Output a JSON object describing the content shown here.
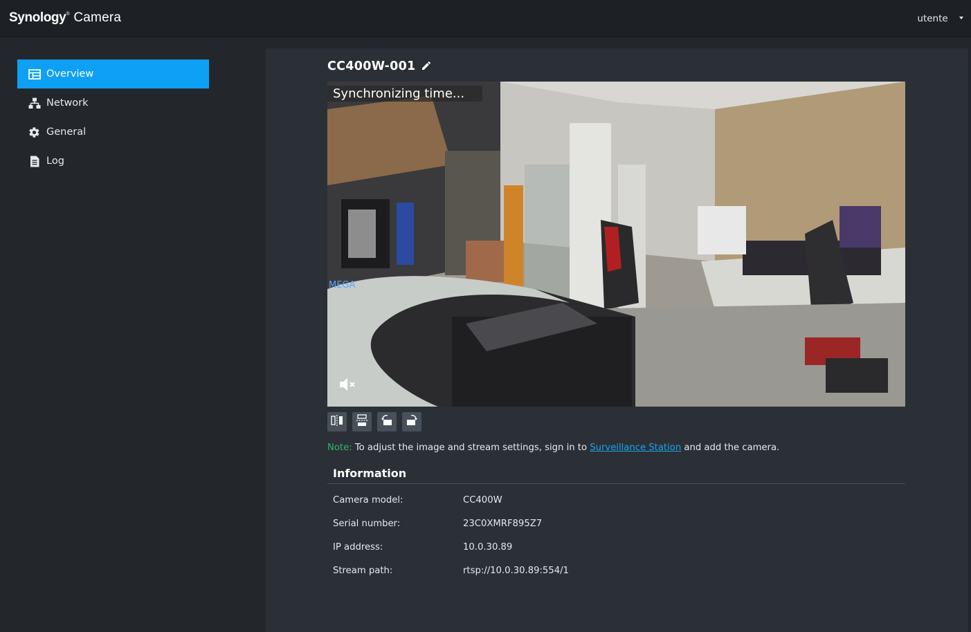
{
  "app": {
    "brand": "Synology",
    "brand_mark": "®",
    "product": "Camera"
  },
  "user_menu": {
    "label": "utente"
  },
  "sidebar": {
    "items": [
      {
        "label": "Overview",
        "icon": "overview-icon",
        "active": true
      },
      {
        "label": "Network",
        "icon": "network-icon",
        "active": false
      },
      {
        "label": "General",
        "icon": "gear-icon",
        "active": false
      },
      {
        "label": "Log",
        "icon": "log-icon",
        "active": false
      }
    ]
  },
  "camera": {
    "name": "CC400W-001",
    "overlay_text": "Synchronizing time...",
    "audio": "muted"
  },
  "toolbar": {
    "buttons": [
      "flip-horizontal-icon",
      "flip-vertical-icon",
      "rotate-left-icon",
      "rotate-right-icon"
    ]
  },
  "note": {
    "prefix": "Note:",
    "text_before": " To adjust the image and stream settings, sign in to ",
    "link": "Surveillance Station",
    "text_after": " and add the camera."
  },
  "information": {
    "heading": "Information",
    "rows": [
      {
        "label": "Camera model:",
        "value": "CC400W"
      },
      {
        "label": "Serial number:",
        "value": "23C0XMRF895Z7"
      },
      {
        "label": "IP address:",
        "value": "10.0.30.89"
      },
      {
        "label": "Stream path:",
        "value": "rtsp://10.0.30.89:554/1"
      }
    ]
  },
  "colors": {
    "accent": "#0ea0f5",
    "note_prefix": "#2fb66a",
    "link": "#1aa3f0",
    "topbar": "#1d2126",
    "panel": "#2b3036"
  }
}
